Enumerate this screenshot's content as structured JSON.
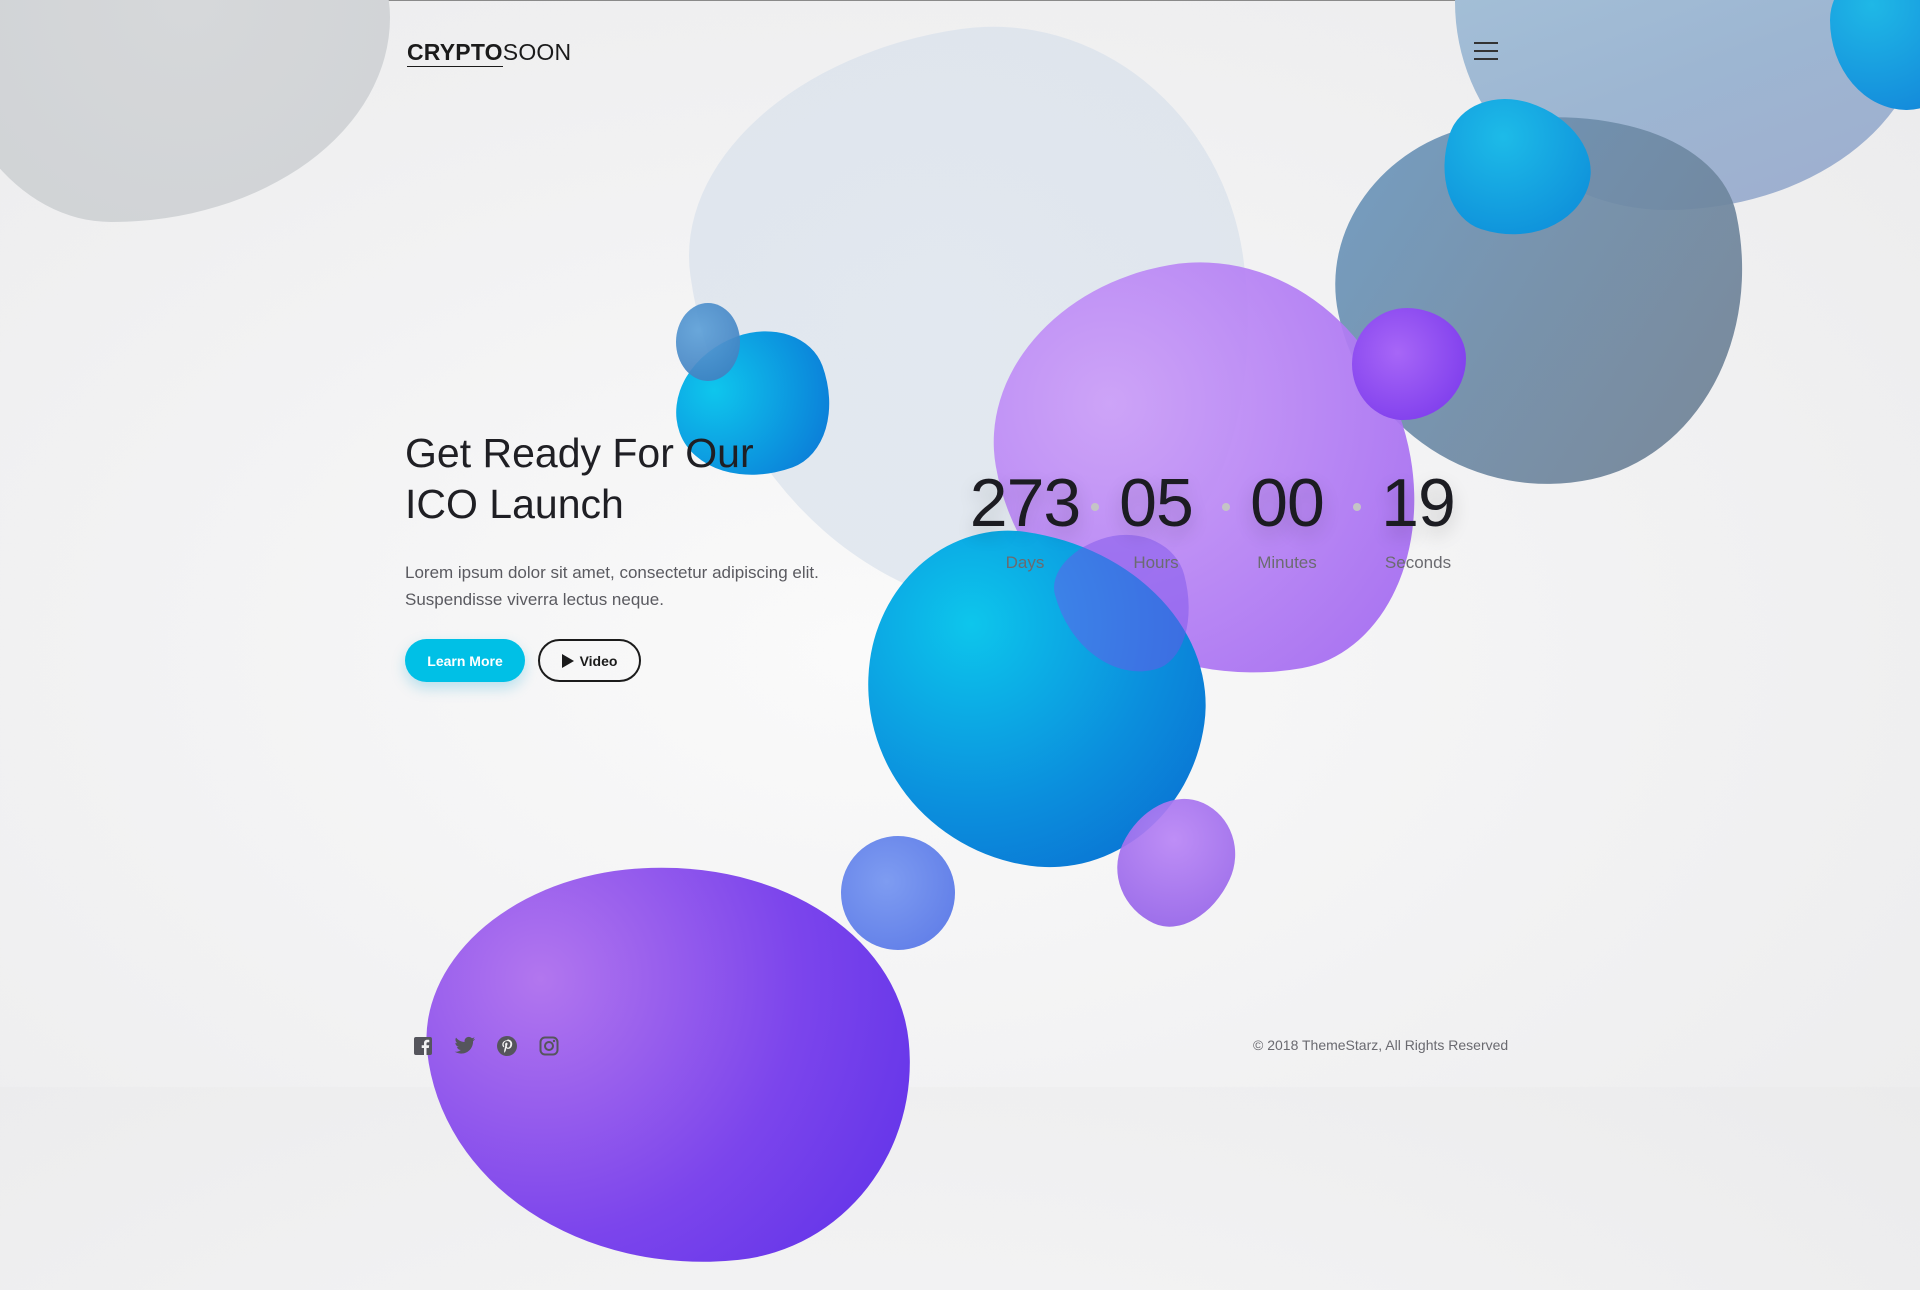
{
  "header": {
    "logo_bold": "CRYPTO",
    "logo_light": "SOON",
    "menu_icon": "hamburger-menu-icon"
  },
  "hero": {
    "title_line1": "Get Ready For Our",
    "title_line2": "ICO Launch",
    "desc_line1": "Lorem ipsum dolor sit amet, consectetur adipiscing elit.",
    "desc_line2": "Suspendisse viverra lectus neque.",
    "learn_more_label": "Learn More",
    "video_label": "Video"
  },
  "countdown": {
    "units": [
      {
        "value": "273",
        "label": "Days"
      },
      {
        "value": "05",
        "label": "Hours"
      },
      {
        "value": "00",
        "label": "Minutes"
      },
      {
        "value": "19",
        "label": "Seconds"
      }
    ]
  },
  "footer": {
    "social_icons": [
      "facebook-icon",
      "twitter-icon",
      "pinterest-icon",
      "instagram-icon"
    ],
    "copyright": "© 2018 ThemeStarz, All Rights Reserved"
  },
  "colors": {
    "accent": "#00c0e6",
    "text_dark": "#1f1f24",
    "text_muted": "#5a5a60",
    "blob_purple": "#7c45ec",
    "blob_blue": "#0b8fdd"
  }
}
